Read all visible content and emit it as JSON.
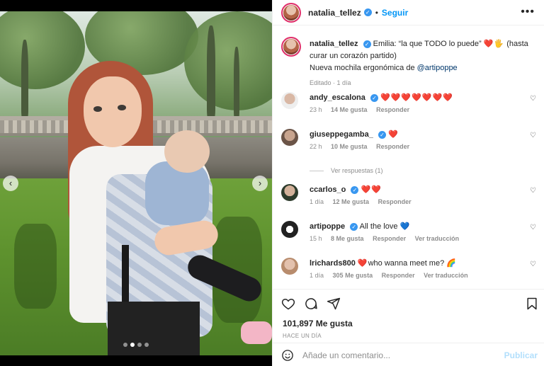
{
  "post": {
    "username": "natalia_tellez",
    "follow_label": "Seguir",
    "separator": "•",
    "more_label": "•••"
  },
  "caption": {
    "username": "natalia_tellez",
    "text_part1": "Emilia: “la que TODO lo puede” ",
    "emoji1": "❤️🖐",
    "text_part2": " (hasta curar un corazón partido)",
    "text_line2": "Nueva mochila ergonómica de ",
    "mention": "@artipoppe",
    "meta": "Editado · 1 día"
  },
  "comments": [
    {
      "username": "andy_escalona",
      "verified": true,
      "text": "",
      "emoji": "❤️❤️❤️❤️❤️❤️❤️",
      "time": "23 h",
      "likes": "14 Me gusta",
      "reply": "Responder",
      "translate": ""
    },
    {
      "username": "giuseppegamba_",
      "verified": true,
      "text": "",
      "emoji": "❤️",
      "time": "22 h",
      "likes": "10 Me gusta",
      "reply": "Responder",
      "translate": ""
    },
    {
      "username": "ccarlos_o",
      "verified": true,
      "text": "",
      "emoji": "❤️❤️",
      "time": "1 día",
      "likes": "12 Me gusta",
      "reply": "Responder",
      "translate": ""
    },
    {
      "username": "artipoppe",
      "verified": true,
      "text": "All the love ",
      "emoji": "💙",
      "time": "15 h",
      "likes": "8 Me gusta",
      "reply": "Responder",
      "translate": "Ver traducción"
    },
    {
      "username": "lrichards800",
      "verified": false,
      "text": "who wanna meet me? ",
      "emoji_before": "❤️",
      "emoji": "🌈",
      "time": "1 día",
      "likes": "305 Me gusta",
      "reply": "Responder",
      "translate": "Ver traducción"
    }
  ],
  "view_replies": "Ver respuestas (1)",
  "likes_count": "101,897 Me gusta",
  "date": "HACE UN DÍA",
  "add_comment": {
    "placeholder": "Añade un comentario...",
    "post_label": "Publicar"
  },
  "media": {
    "carousel_dots": 4,
    "active_dot": 1
  },
  "colors": {
    "accent": "#0095f6",
    "verified": "#3897f0",
    "heart": "#ed1c24",
    "muted": "#8e8e8e"
  }
}
